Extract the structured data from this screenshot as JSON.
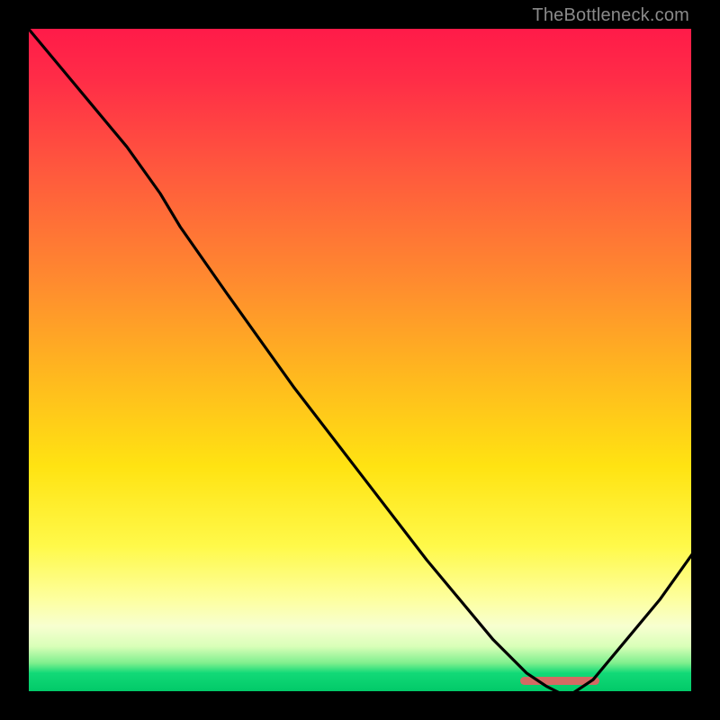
{
  "watermark": {
    "text": "TheBottleneck.com"
  },
  "chart_data": {
    "type": "line",
    "title": "",
    "xlabel": "",
    "ylabel": "",
    "xlim": [
      0,
      100
    ],
    "ylim": [
      0,
      100
    ],
    "grid": false,
    "legend": false,
    "annotations": [],
    "x": [
      0,
      5,
      10,
      15,
      20,
      23,
      30,
      40,
      50,
      60,
      70,
      75,
      78,
      80,
      82,
      85,
      90,
      95,
      100
    ],
    "y": [
      100,
      94,
      88,
      82,
      75,
      70,
      60,
      46,
      33,
      20,
      8,
      3,
      1,
      0,
      0,
      2,
      8,
      14,
      21
    ],
    "notes": "Values estimated from pixel positions; no axis ticks or labels are rendered in the image. y=0 is the plot bottom, y=100 the top.",
    "bottom_marker": {
      "x_start": 74,
      "x_end": 86,
      "color": "#d46a63"
    },
    "background_gradient_description": "vertical red-to-green heat gradient"
  }
}
